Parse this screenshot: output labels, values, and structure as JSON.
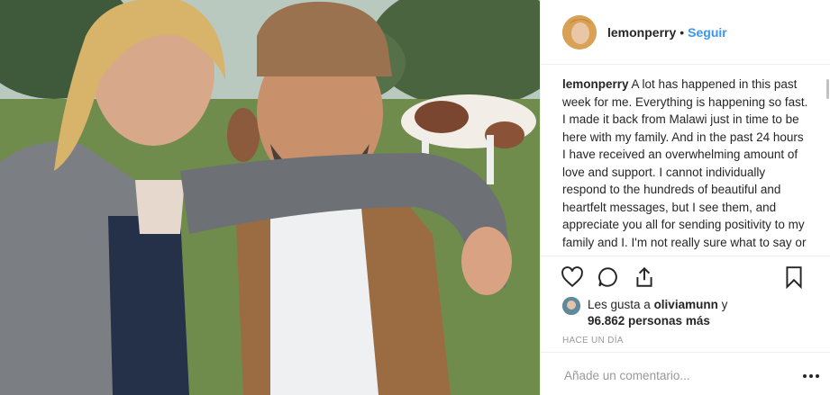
{
  "header": {
    "username": "lemonperry",
    "separator": "•",
    "follow_label": "Seguir"
  },
  "caption": {
    "username": "lemonperry",
    "text": " A lot has happened in this past week for me. Everything is happening so fast. I made it back from Malawi just in time to be here with my family. And in the past 24 hours I have received an overwhelming amount of love and support. I cannot individually respond to the hundreds of beautiful and heartfelt messages, but I see them, and appreciate you all for sending positivity to my family and I. I'm not really sure what to say or do in this situation, it's"
  },
  "actions": {
    "like_icon": "heart-icon",
    "comment_icon": "speech-bubble-icon",
    "share_icon": "share-icon",
    "save_icon": "bookmark-icon"
  },
  "likes": {
    "prefix": "Les gusta a ",
    "liker": "oliviamunn",
    "middle": " y",
    "count": "96.862 personas más"
  },
  "timestamp": "HACE UN DÍA",
  "comment": {
    "placeholder": "Añade un comentario...",
    "more_icon": "ellipsis-icon"
  },
  "colors": {
    "link": "#3897f0",
    "text": "#262626",
    "muted": "#999999"
  }
}
